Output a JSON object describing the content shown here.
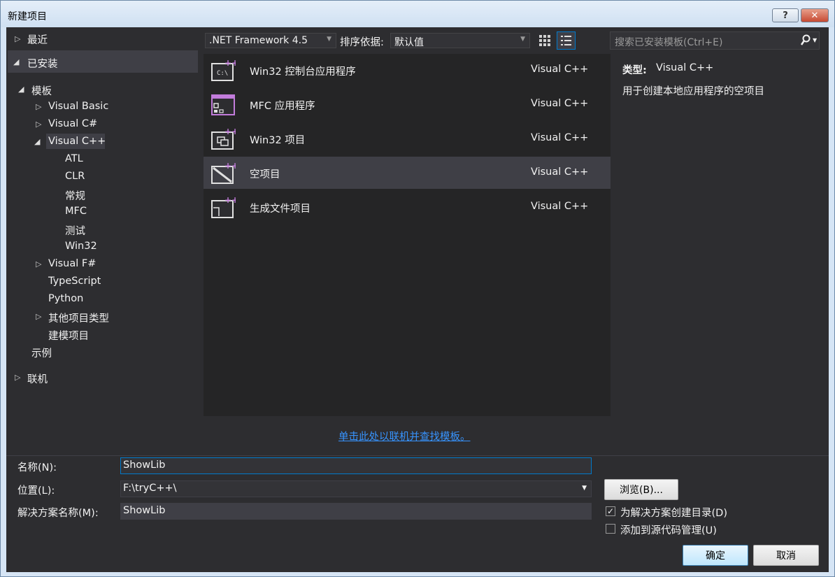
{
  "window": {
    "title": "新建项目",
    "help_label": "?",
    "close_label": "✕"
  },
  "tree": {
    "recent": "最近",
    "installed": "已安装",
    "templates": "模板",
    "items": [
      {
        "label": "Visual Basic"
      },
      {
        "label": "Visual C#"
      },
      {
        "label": "Visual C++"
      },
      {
        "label": "ATL"
      },
      {
        "label": "CLR"
      },
      {
        "label": "常规"
      },
      {
        "label": "MFC"
      },
      {
        "label": "测试"
      },
      {
        "label": "Win32"
      },
      {
        "label": "Visual F#"
      },
      {
        "label": "TypeScript"
      },
      {
        "label": "Python"
      },
      {
        "label": "其他项目类型"
      },
      {
        "label": "建模项目"
      }
    ],
    "samples": "示例",
    "online": "联机"
  },
  "toolbar": {
    "framework": ".NET Framework 4.5",
    "sort_label": "排序依据:",
    "sort_value": "默认值",
    "search_placeholder": "搜索已安装模板(Ctrl+E)"
  },
  "templates": [
    {
      "name": "Win32 控制台应用程序",
      "lang": "Visual C++"
    },
    {
      "name": "MFC 应用程序",
      "lang": "Visual C++"
    },
    {
      "name": "Win32 项目",
      "lang": "Visual C++"
    },
    {
      "name": "空项目",
      "lang": "Visual C++"
    },
    {
      "name": "生成文件项目",
      "lang": "Visual C++"
    }
  ],
  "description": {
    "type_label": "类型:",
    "type_value": "Visual C++",
    "text": "用于创建本地应用程序的空项目"
  },
  "online_link": "单击此处以联机并查找模板。",
  "form": {
    "name_label": "名称(N):",
    "name_value": "ShowLib",
    "location_label": "位置(L):",
    "location_value": "F:\\tryC++\\",
    "solution_label": "解决方案名称(M):",
    "solution_value": "ShowLib",
    "browse_label": "浏览(B)...",
    "create_dir_label": "为解决方案创建目录(D)",
    "create_dir_checked": "✓",
    "add_scc_label": "添加到源代码管理(U)",
    "ok_label": "确定",
    "cancel_label": "取消"
  },
  "colors": {
    "accent": "#007acc",
    "background": "#2d2d30",
    "list_bg": "#252526",
    "selection": "#3f3f46",
    "link": "#3794ff"
  }
}
